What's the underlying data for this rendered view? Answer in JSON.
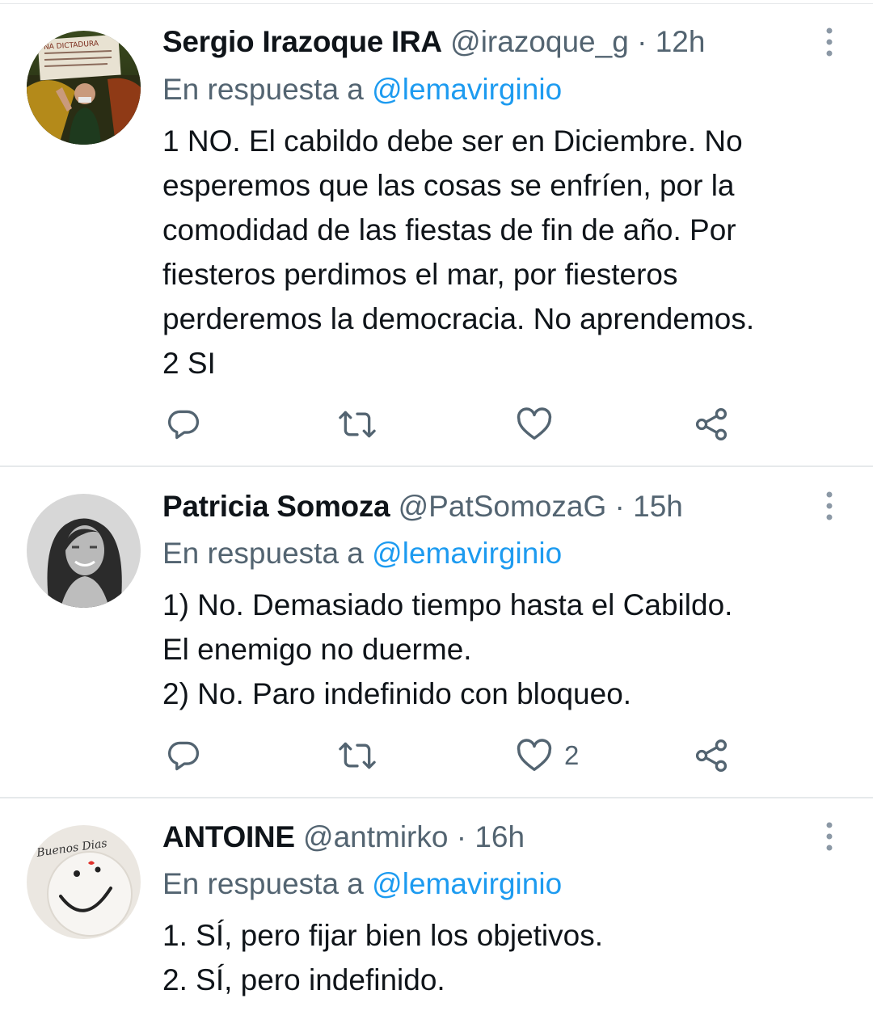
{
  "tweets": [
    {
      "name": "Sergio Irazoque IRA",
      "handle": "@irazoque_g",
      "time": "12h",
      "reply_prefix": "En respuesta a",
      "reply_handle": "@lemavirginio",
      "lines": [
        "1 NO. El cabildo debe ser en Diciembre. No",
        "esperemos que las cosas se enfríen, por la",
        "comodidad de las fiestas de fin de año. Por",
        "fiesteros perdimos el mar, por fiesteros",
        "perderemos la democracia. No aprendemos.",
        "2 SI"
      ],
      "like_count": ""
    },
    {
      "name": "Patricia Somoza",
      "handle": "@PatSomozaG",
      "time": "15h",
      "reply_prefix": "En respuesta a",
      "reply_handle": "@lemavirginio",
      "lines": [
        "1) No. Demasiado tiempo hasta el Cabildo.",
        "El enemigo no duerme.",
        "2) No. Paro indefinido con bloqueo."
      ],
      "like_count": "2"
    },
    {
      "name": "ANTOINE",
      "handle": "@antmirko",
      "time": "16h",
      "reply_prefix": "En respuesta a",
      "reply_handle": "@lemavirginio",
      "lines": [
        "1. SÍ, pero fijar bien los objetivos.",
        "2. SÍ, pero indefinido."
      ],
      "avatar_text": "Buenos Dias"
    }
  ],
  "separator": "·",
  "icons": {
    "reply": "reply-icon",
    "retweet": "retweet-icon",
    "like": "heart-icon",
    "share": "share-icon",
    "more": "more-vertical-icon"
  },
  "colors": {
    "text": "#0f1419",
    "secondary": "#536471",
    "link": "#1d9bf0",
    "divider": "#e6e9eb"
  }
}
